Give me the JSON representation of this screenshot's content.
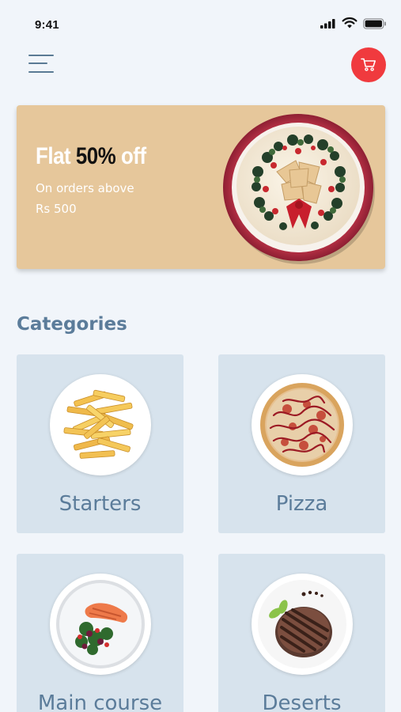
{
  "status_bar": {
    "time": "9:41"
  },
  "header": {
    "menu_icon": "hamburger-menu-icon",
    "cart_icon": "shopping-cart-icon",
    "cart_color": "#f03a3e"
  },
  "offer": {
    "headline_part1": "Flat ",
    "headline_percent": "50%",
    "headline_part2": " off",
    "subtext_line1": "On orders above",
    "subtext_line2": "Rs 500",
    "background_color": "#e6c79b"
  },
  "categories": {
    "heading": "Categories",
    "items": [
      {
        "label": "Starters",
        "icon": "french-fries-image"
      },
      {
        "label": "Pizza",
        "icon": "pizza-image"
      },
      {
        "label": "Main course",
        "icon": "salmon-salad-plate-image"
      },
      {
        "label": "Deserts",
        "icon": "chocolate-dessert-image"
      }
    ]
  },
  "colors": {
    "background": "#f1f5fa",
    "card": "#d7e3ed",
    "heading": "#5b7c9a"
  }
}
